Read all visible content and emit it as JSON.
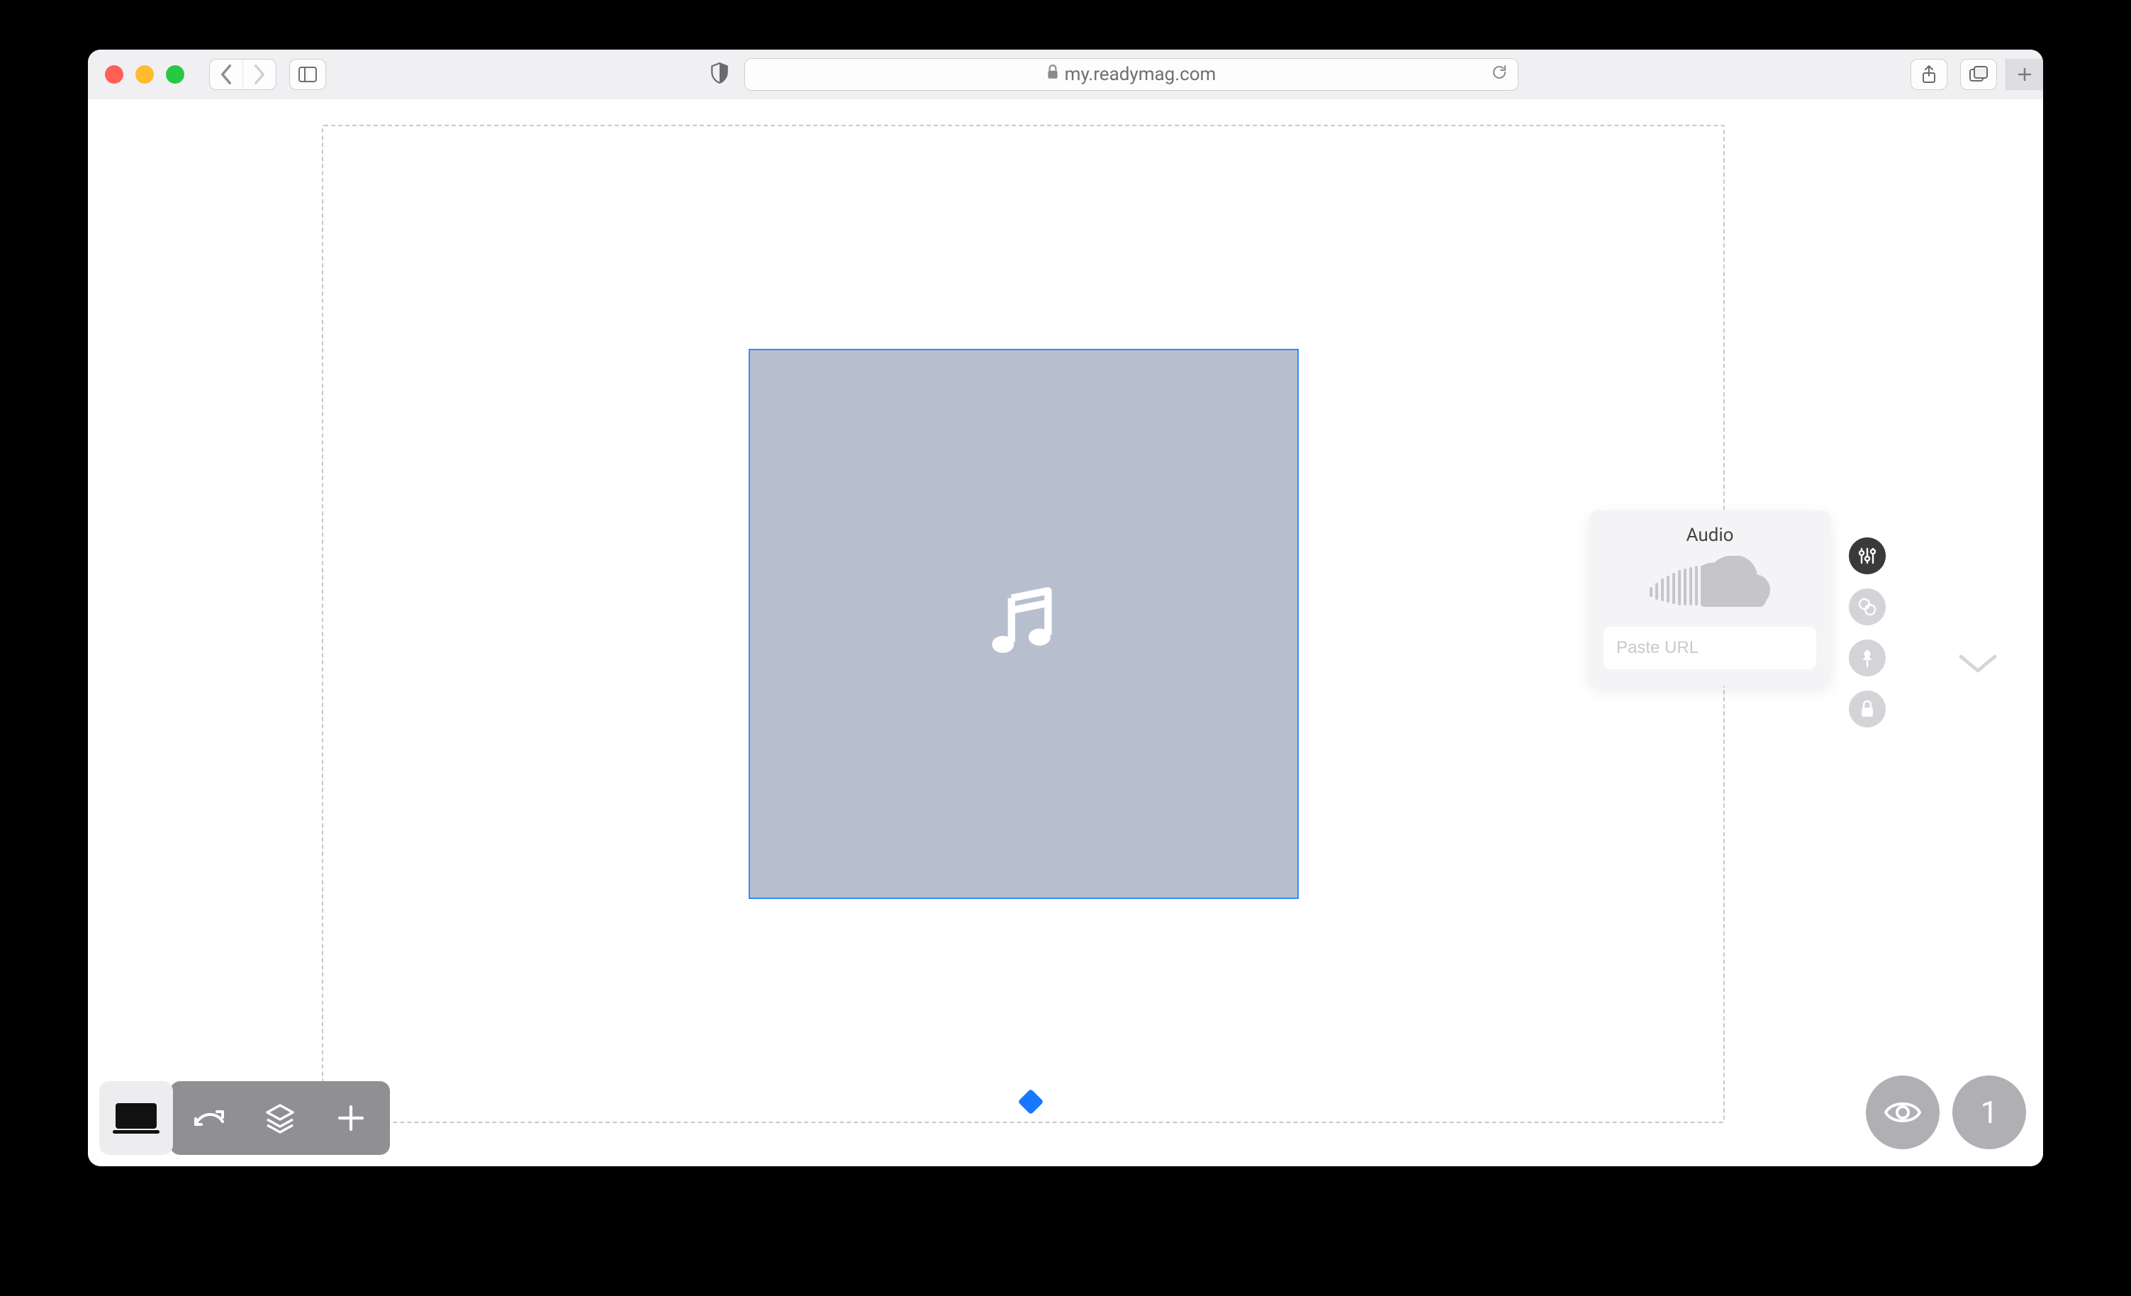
{
  "browser": {
    "url_display": "my.readymag.com"
  },
  "panel": {
    "title": "Audio",
    "url_placeholder": "Paste URL"
  },
  "page_counter": "1"
}
